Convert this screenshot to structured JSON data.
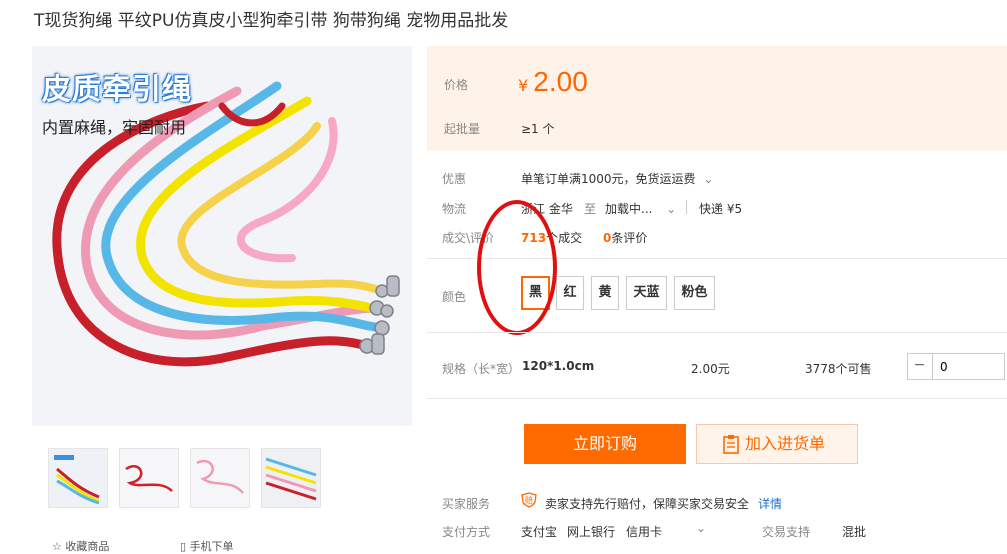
{
  "product": {
    "title": "T现货狗绳 平纹PU仿真皮小型狗牵引带 狗带狗绳 宠物用品批发"
  },
  "image": {
    "promo_title": "皮质牵引绳",
    "promo_subtitle": "内置麻绳，牢固耐用"
  },
  "price": {
    "label": "价格",
    "currency": "¥",
    "value": "2.00",
    "moq_label": "起批量",
    "moq_value": "≥1 个"
  },
  "promo": {
    "label": "优惠",
    "text": "单笔订单满1000元，免货运运费"
  },
  "logistics": {
    "label": "物流",
    "from": "浙江 金华",
    "to_label": "至",
    "to_value": "加载中...",
    "express": "快递 ¥5"
  },
  "deals": {
    "label": "成交\\评价",
    "count": "713",
    "count_suffix": "个成交",
    "reviews": "0",
    "reviews_suffix": "条评价"
  },
  "color": {
    "label": "颜色",
    "options": [
      "黑",
      "红",
      "黄",
      "天蓝",
      "粉色"
    ],
    "selected": "黑"
  },
  "spec": {
    "label": "规格（长*宽）",
    "value": "120*1.0cm",
    "price": "2.00元",
    "stock": "3778个可售",
    "qty_value": "0",
    "minus": "−"
  },
  "actions": {
    "buy": "立即订购",
    "add_cart": "加入进货单"
  },
  "services": {
    "buyer_label": "买家服务",
    "buyer_badge": "赔",
    "buyer_text": "卖家支持先行赔付，保障买家交易安全",
    "details_link": "详情",
    "payment_label": "支付方式",
    "payment_methods": [
      "支付宝",
      "网上银行",
      "信用卡"
    ],
    "trade_label": "交易支持",
    "trade_value": "混批"
  },
  "left_footer": {
    "frag1": "收藏商品",
    "frag2": "手机下单"
  },
  "colors": {
    "accent": "#ff6600",
    "price_bg": "#fff2e8",
    "link": "#1f6fcb",
    "annotation": "#e01010"
  },
  "icons": [
    "chevron-down-icon",
    "clipboard-icon",
    "guarantee-badge-icon"
  ]
}
